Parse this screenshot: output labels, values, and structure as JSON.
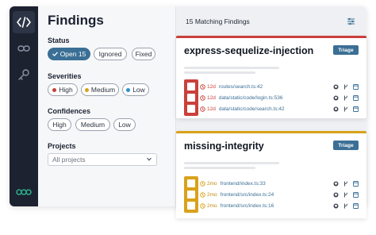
{
  "colors": {
    "accent": "#3b6f95",
    "high": "#c9403a",
    "medium": "#d9a21b",
    "low": "#2e8fd0",
    "brand": "#2aa88a"
  },
  "rail": {
    "icons": [
      "code-icon",
      "link-icon",
      "key-icon",
      "logo-icon"
    ]
  },
  "filters": {
    "title": "Findings",
    "status": {
      "label": "Status",
      "options": [
        "Open 15",
        "Ignored",
        "Fixed"
      ]
    },
    "severities": {
      "label": "Severities",
      "options": [
        "High",
        "Medium",
        "Low"
      ]
    },
    "confidences": {
      "label": "Confidences",
      "options": [
        "High",
        "Medium",
        "Low"
      ]
    },
    "projects": {
      "label": "Projects",
      "value": "All projects"
    }
  },
  "results": {
    "header": "15 Matching Findings",
    "cards": [
      {
        "title": "express-sequelize-injection",
        "triage": "Triage",
        "severity_color": "#c9403a",
        "rows": [
          {
            "age": "12d",
            "path": "routes/search.ts:42"
          },
          {
            "age": "12d",
            "path": "data/static/code/login.ts:536"
          },
          {
            "age": "12d",
            "path": "data/static/code/search.ts:42"
          }
        ]
      },
      {
        "title": "missing-integrity",
        "triage": "Triage",
        "severity_color": "#d9a21b",
        "rows": [
          {
            "age": "2mo",
            "path": "frontend/index.ts:33"
          },
          {
            "age": "2mo",
            "path": "frontend/src/index.ts:24"
          },
          {
            "age": "2mo",
            "path": "frontend/src/index.ts:16"
          }
        ]
      }
    ]
  }
}
